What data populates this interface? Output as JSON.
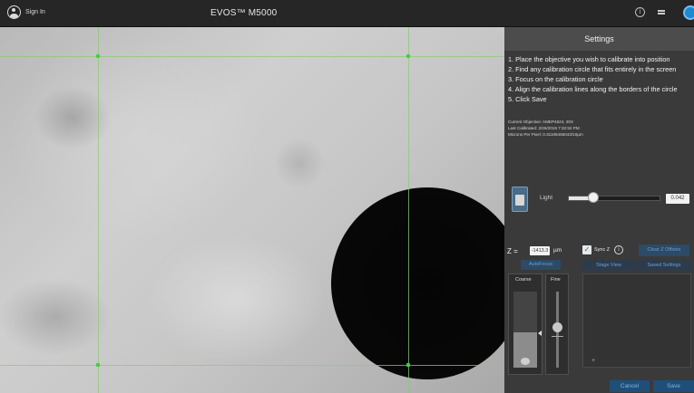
{
  "topbar": {
    "signin_label": "Sign In",
    "app_title": "EVOS™ M5000",
    "info_glyph": "i",
    "accent_color": "#1e88d0"
  },
  "viewport": {
    "icons": [
      "calibration-circle",
      "calibration-handle"
    ]
  },
  "panel": {
    "title": "Settings",
    "instructions": [
      "1. Place the objective you wish to calibrate into position",
      "2. Find any calibration circle that fits entirely in the screen",
      "3. Focus on the calibration circle",
      "4. Align the calibration lines along the borders of the circle",
      "5. Click Save"
    ],
    "info": {
      "objective": "Current Objective: AMEP4624, 20X",
      "last_calibrated": "Last Calibrated: 2/26/2019 7:32:52 PM",
      "microns_per_pixel": "Microns Per Pixel: 0.31106465043/10µm"
    },
    "light": {
      "label": "Light",
      "value": "0.042",
      "level": 0.25
    },
    "z": {
      "label": "Z =",
      "value": "-1413.3",
      "unit": "µm",
      "sync_label": "Sync Z",
      "sync_checked": true,
      "info_glyph": "i",
      "clear_offsets_label": "Clear Z Offsets"
    },
    "autofocus_label": "AutoFocus",
    "tabs": [
      "Stage View",
      "Saved Settings"
    ],
    "coarse_label": "Coarse",
    "fine_label": "Fine",
    "add_glyph": "+",
    "cancel_label": "Cancel",
    "save_label": "Save"
  }
}
